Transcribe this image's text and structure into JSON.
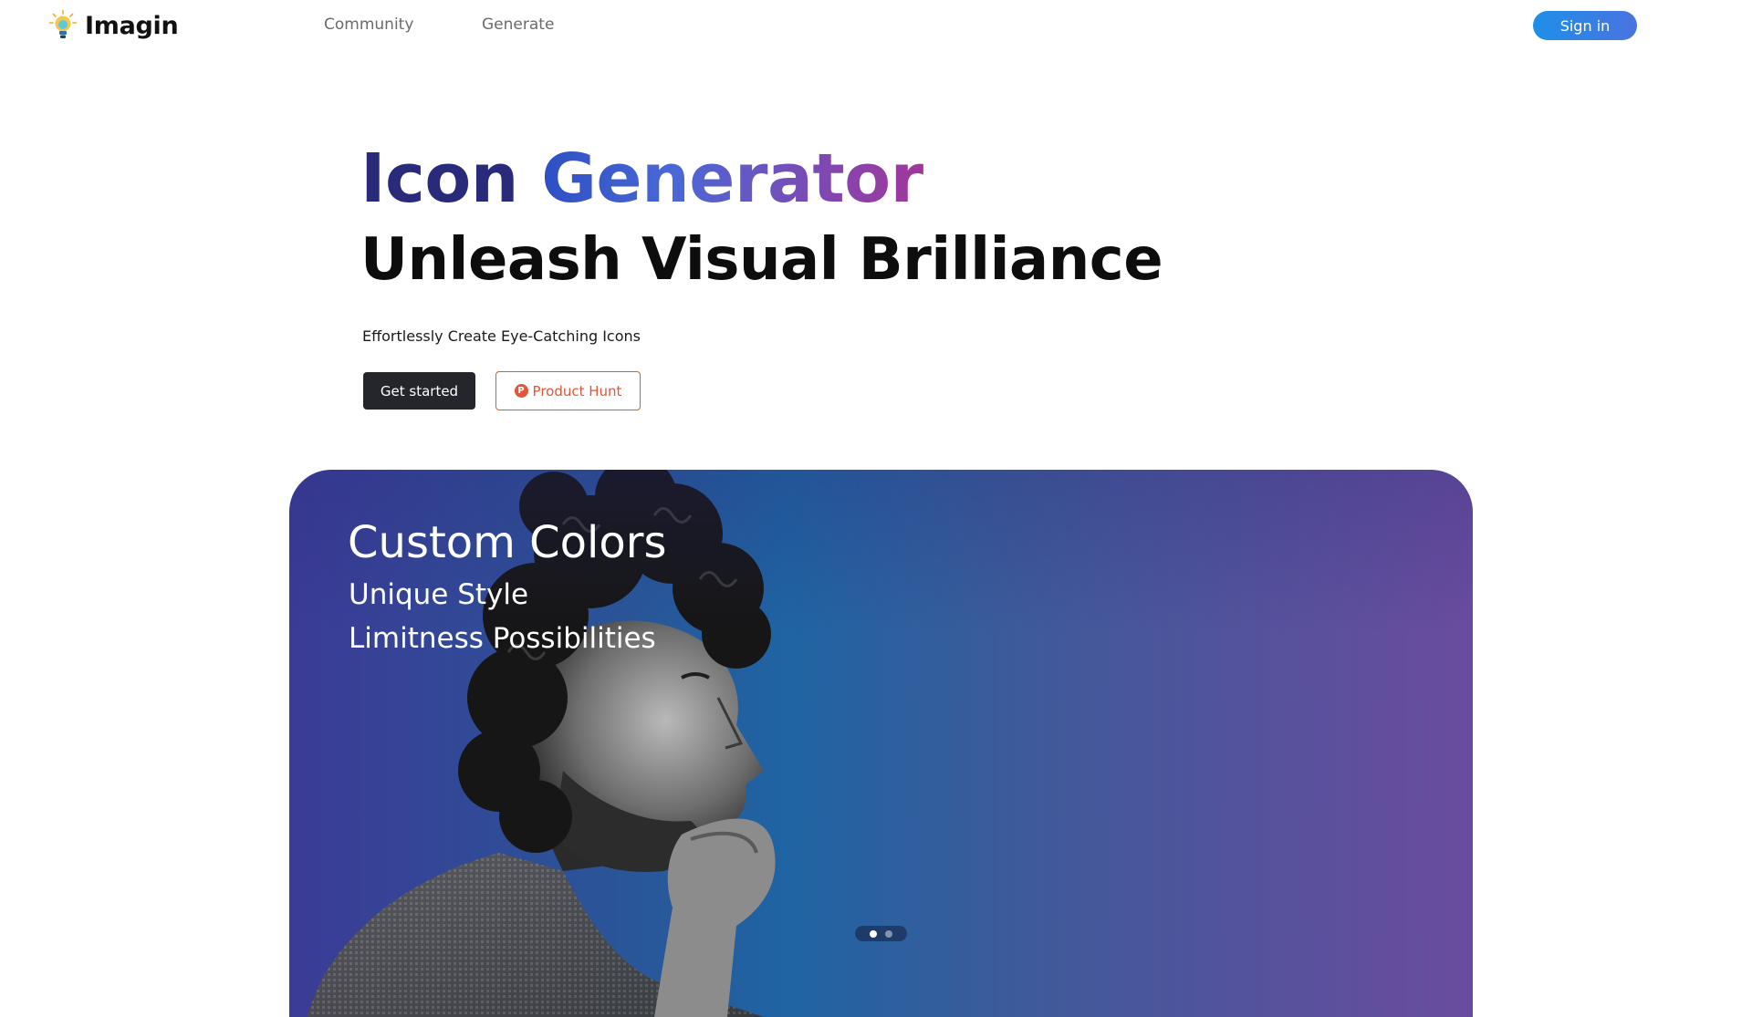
{
  "header": {
    "brand_name": "Imagin",
    "brand_icon": "lightbulb-icon",
    "nav": [
      "Community",
      "Generate"
    ],
    "sign_in_label": "Sign in"
  },
  "hero": {
    "title_first": "Icon",
    "title_second": "Generator",
    "subtitle": "Unleash Visual Brilliance",
    "tagline": "Effortlessly Create Eye-Catching Icons",
    "primary_button": "Get started",
    "secondary_button": "Product Hunt",
    "secondary_icon": "product-hunt-icon"
  },
  "showcase": {
    "heading": "Custom Colors",
    "lines": [
      "Unique Style",
      "Limitness Possibilities"
    ],
    "slide_count": 2,
    "active_slide": 1
  },
  "colors": {
    "accent": "#1e8fe8",
    "product_hunt": "#e2553a",
    "dark_button": "#25262b",
    "title_navy": "#2a2a7a"
  }
}
